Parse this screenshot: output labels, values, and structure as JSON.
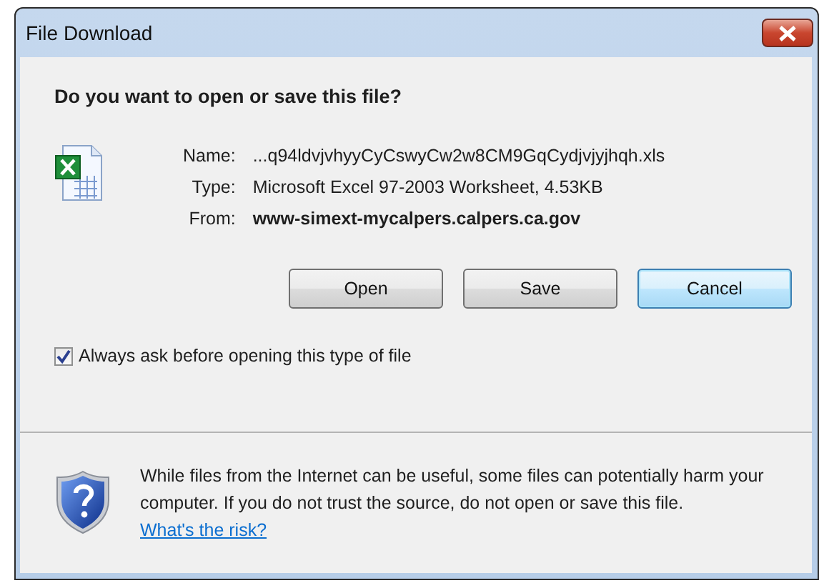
{
  "window": {
    "title": "File Download"
  },
  "question": "Do you want to open or save this file?",
  "details": [
    {
      "label": "Name:",
      "value": "...q94ldvjvhyyCyCswyCw2w8CM9GqCydjvjyjhqh.xls",
      "bold": false
    },
    {
      "label": "Type:",
      "value": "Microsoft Excel 97-2003 Worksheet, 4.53KB",
      "bold": false
    },
    {
      "label": "From:",
      "value": "www-simext-mycalpers.calpers.ca.gov",
      "bold": true
    }
  ],
  "buttons": [
    {
      "label": "Open",
      "focused": false
    },
    {
      "label": "Save",
      "focused": false
    },
    {
      "label": "Cancel",
      "focused": true
    }
  ],
  "always_ask": {
    "label": "Always ask before opening this type of file",
    "checked": true
  },
  "warning": {
    "text": "While files from the Internet can be useful, some files can potentially harm your computer. If you do not trust the source, do not open or save this file.",
    "link": "What's the risk?"
  }
}
